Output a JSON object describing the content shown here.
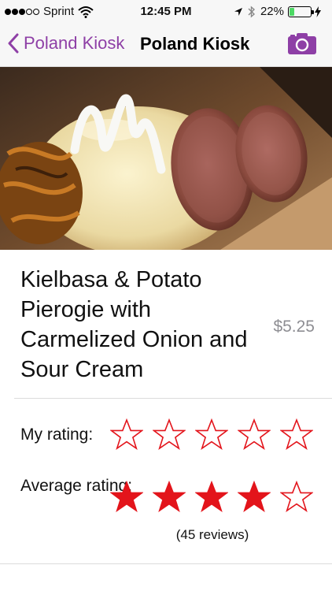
{
  "status_bar": {
    "carrier": "Sprint",
    "time": "12:45 PM",
    "battery_percent": "22%",
    "battery_level": 0.22,
    "icons": [
      "signal-dots-icon",
      "wifi-icon",
      "location-arrow-icon",
      "bluetooth-icon",
      "battery-icon",
      "charging-bolt-icon"
    ]
  },
  "nav": {
    "back_label": "Poland Kiosk",
    "title": "Poland Kiosk",
    "right_icon": "camera-icon",
    "accent_color": "#8e3fa6"
  },
  "item": {
    "name": "Kielbasa & Potato Pierogie with Carmelized Onion and Sour Cream",
    "price": "$5.25"
  },
  "ratings": {
    "my_rating_label": "My rating:",
    "my_rating_value": 0,
    "average_rating_label": "Average rating:",
    "average_rating_value": 4,
    "max_stars": 5,
    "reviews_text": "(45 reviews)",
    "star_color": "#e3141b"
  }
}
